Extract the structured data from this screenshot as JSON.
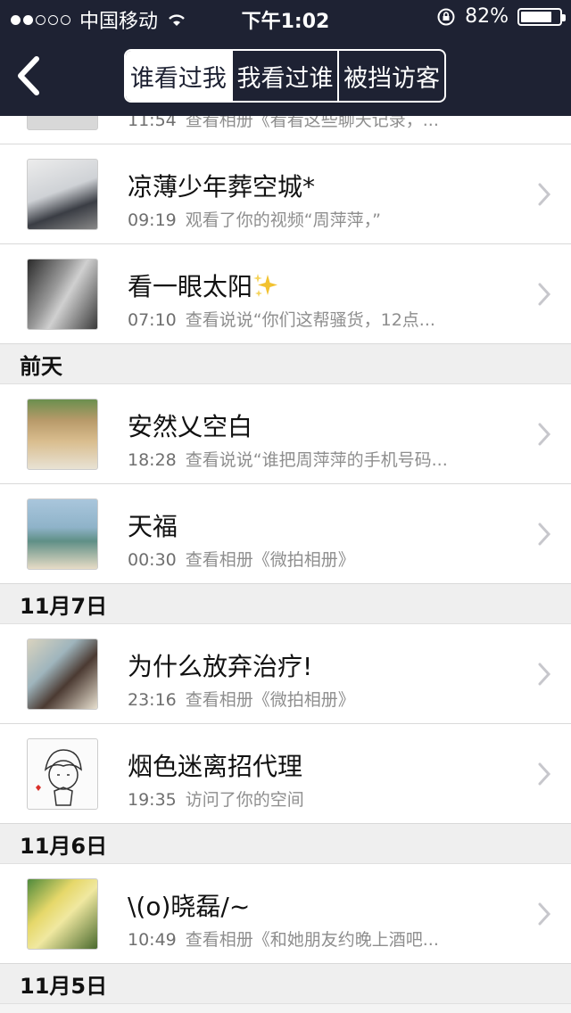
{
  "status_bar": {
    "carrier": "中国移动",
    "time": "下午1:02",
    "battery_text": "82%",
    "battery_level": 0.82
  },
  "nav": {
    "segments": [
      "谁看过我",
      "我看过谁",
      "被挡访客"
    ],
    "active_segment": 0
  },
  "partial_row": {
    "time": "11:54",
    "action": "查看相册《看看这些聊天记录，..."
  },
  "groups": [
    {
      "header": "",
      "rows": [
        {
          "name": "凉薄少年葬空城*",
          "time": "09:19",
          "action": "观看了你的视频“周萍萍，”"
        },
        {
          "name": "看一眼太阳",
          "time": "07:10",
          "action": "查看说说“你们这帮骚货，12点..."
        }
      ]
    },
    {
      "header": "前天",
      "rows": [
        {
          "name": "安然乂空白",
          "time": "18:28",
          "action": "查看说说“谁把周萍萍的手机号码..."
        },
        {
          "name": "天福",
          "time": "00:30",
          "action": "查看相册《微拍相册》"
        }
      ]
    },
    {
      "header": "11月7日",
      "rows": [
        {
          "name": "为什么放弃治疗!",
          "time": "23:16",
          "action": "查看相册《微拍相册》"
        },
        {
          "name": "烟色迷离招代理",
          "time": "19:35",
          "action": "访问了你的空间"
        }
      ]
    },
    {
      "header": "11月6日",
      "rows": [
        {
          "name": "\\(o)晓磊/~",
          "time": "10:49",
          "action": "查看相册《和她朋友约晚上酒吧..."
        }
      ]
    },
    {
      "header": "11月5日",
      "rows": []
    }
  ],
  "colors": {
    "nav_bg": "#1e2233",
    "accent": "#ffffff",
    "list_bg": "#ffffff",
    "section_bg": "#efefef"
  }
}
